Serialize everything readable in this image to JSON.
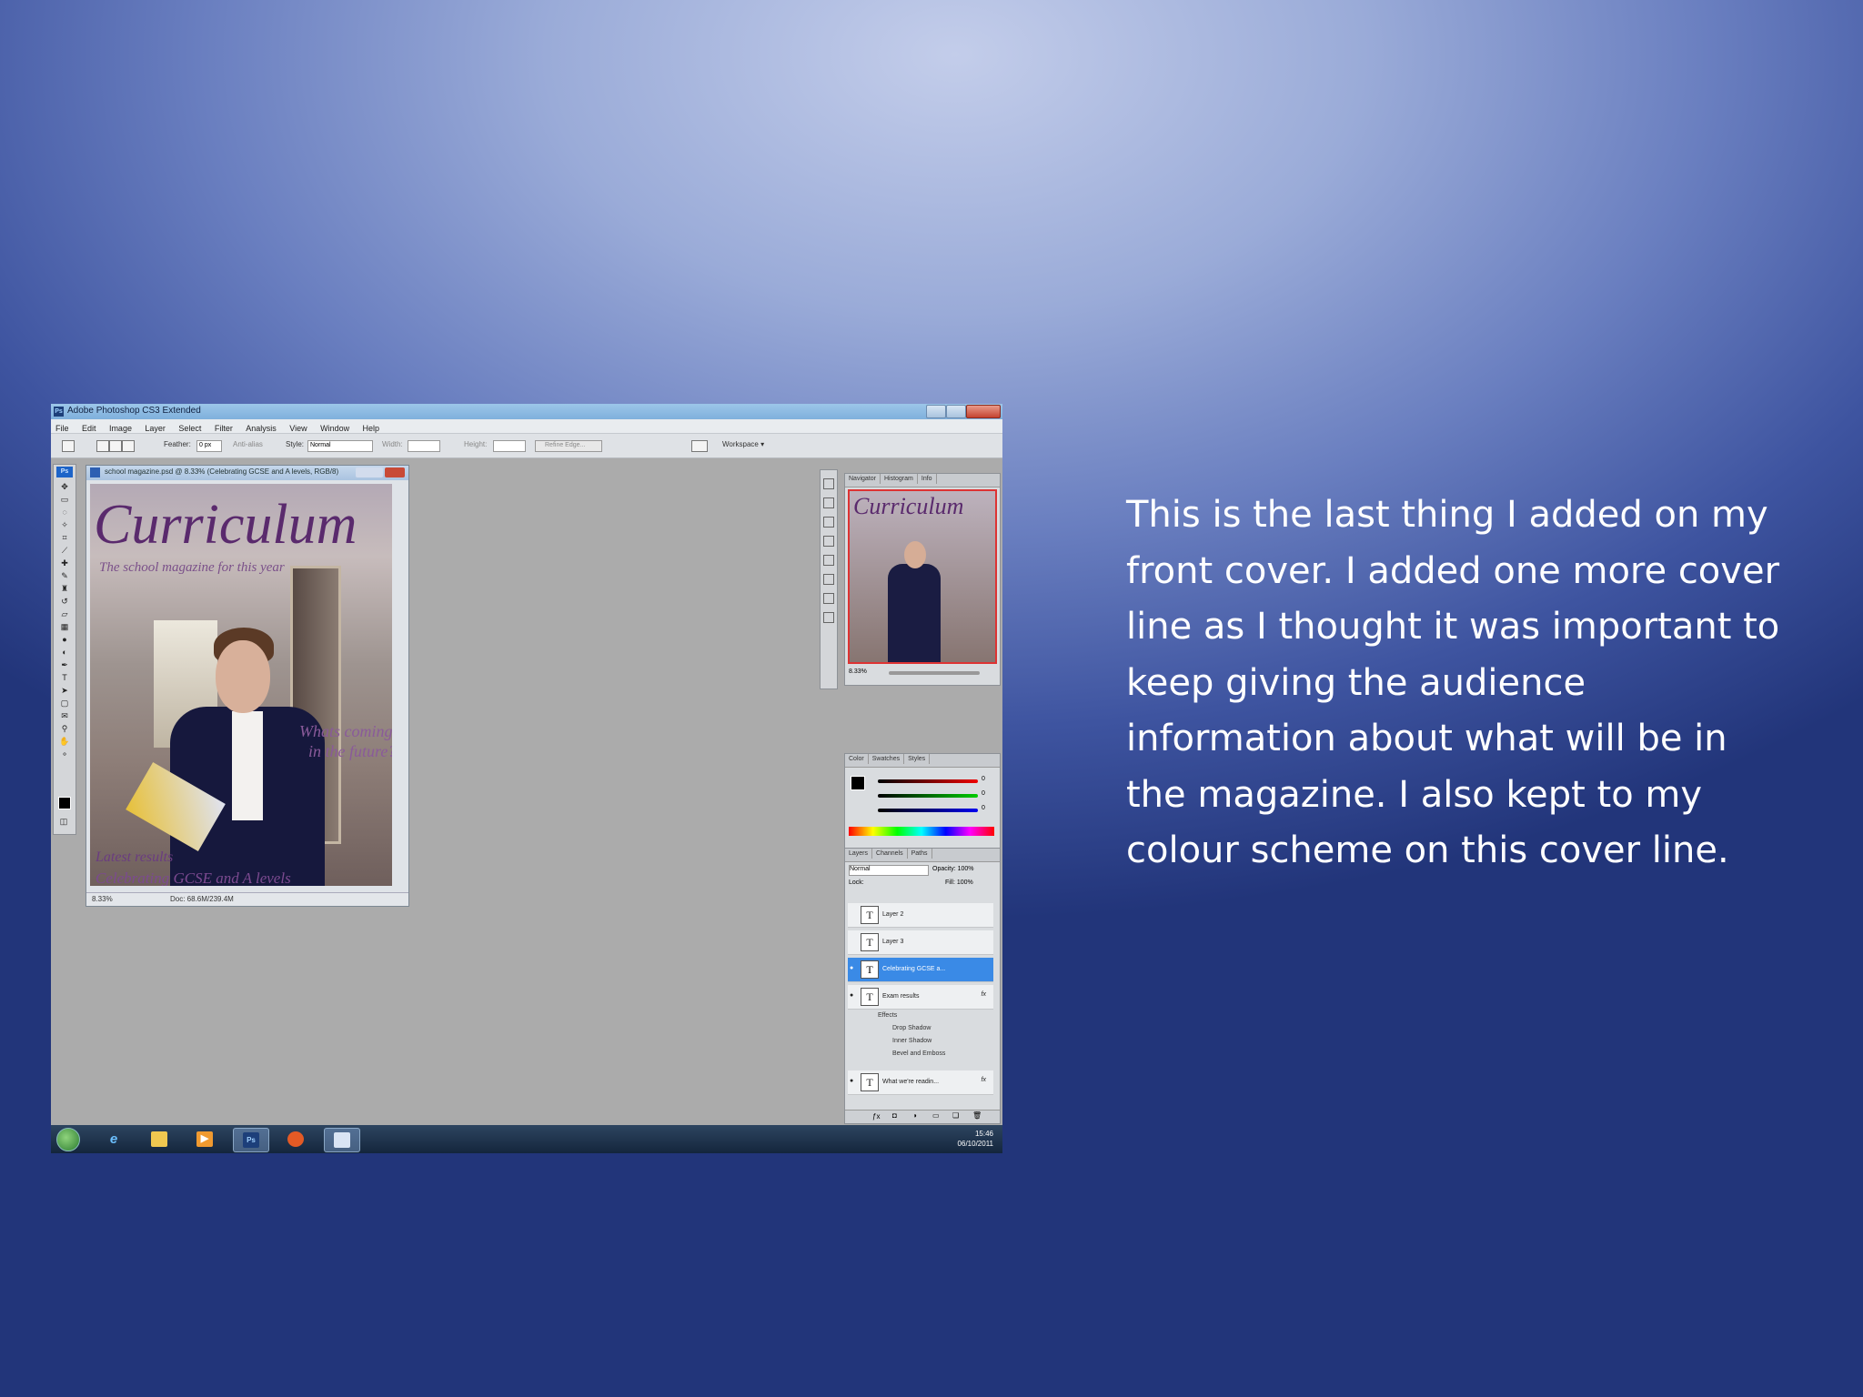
{
  "window": {
    "title": "Adobe Photoshop CS3 Extended"
  },
  "menu": [
    "File",
    "Edit",
    "Image",
    "Layer",
    "Select",
    "Filter",
    "Analysis",
    "View",
    "Window",
    "Help"
  ],
  "options_bar": {
    "feather_label": "Feather:",
    "feather_value": "0 px",
    "antialias_label": "Anti-alias",
    "style_label": "Style:",
    "style_value": "Normal",
    "width_label": "Width:",
    "height_label": "Height:",
    "refine_label": "Refine Edge...",
    "workspace_label": "Workspace ▾"
  },
  "document": {
    "title": "school magazine.psd @ 8.33% (Celebrating GCSE and A levels, RGB/8)",
    "zoom": "8.33%",
    "doc_size": "Doc: 68.6M/239.4M",
    "cover": {
      "masthead": "Curriculum",
      "tagline": "The school magazine for this year",
      "line_1": "Whats coming",
      "line_2": "in the future?",
      "line_3": "Latest results",
      "line_4": "Celebrating GCSE and A levels"
    }
  },
  "panels": {
    "navigator_tabs": [
      "Navigator",
      "Histogram",
      "Info"
    ],
    "navigator_thumb_title": "Curriculum",
    "navigator_zoom": "8.33%",
    "color_tabs": [
      "Color",
      "Swatches",
      "Styles"
    ],
    "color_values": {
      "r": "0",
      "g": "0",
      "b": "0"
    },
    "layers_tabs": [
      "Layers",
      "Channels",
      "Paths"
    ],
    "blend_mode": "Normal",
    "opacity": "Opacity: 100%",
    "fill": "Fill: 100%",
    "lock_label": "Lock:",
    "layers": [
      {
        "name": "Layer 2",
        "visible": false,
        "selected": false
      },
      {
        "name": "Layer 3",
        "visible": false,
        "selected": false
      },
      {
        "name": "Celebrating GCSE a...",
        "visible": true,
        "selected": true
      },
      {
        "name": "Exam results",
        "visible": true,
        "selected": false,
        "fx": true
      },
      {
        "name": "What we're readin...",
        "visible": true,
        "selected": false,
        "fx": true
      }
    ],
    "effects": [
      "Effects",
      "Drop Shadow",
      "Inner Shadow",
      "Bevel and Emboss"
    ]
  },
  "taskbar": {
    "time": "15:46",
    "date": "06/10/2011"
  },
  "caption": "This is the last thing I added on my front cover. I added one more cover line as I thought it was important to keep giving the audience information about what will be in the magazine. I also kept to my colour scheme on this cover line."
}
